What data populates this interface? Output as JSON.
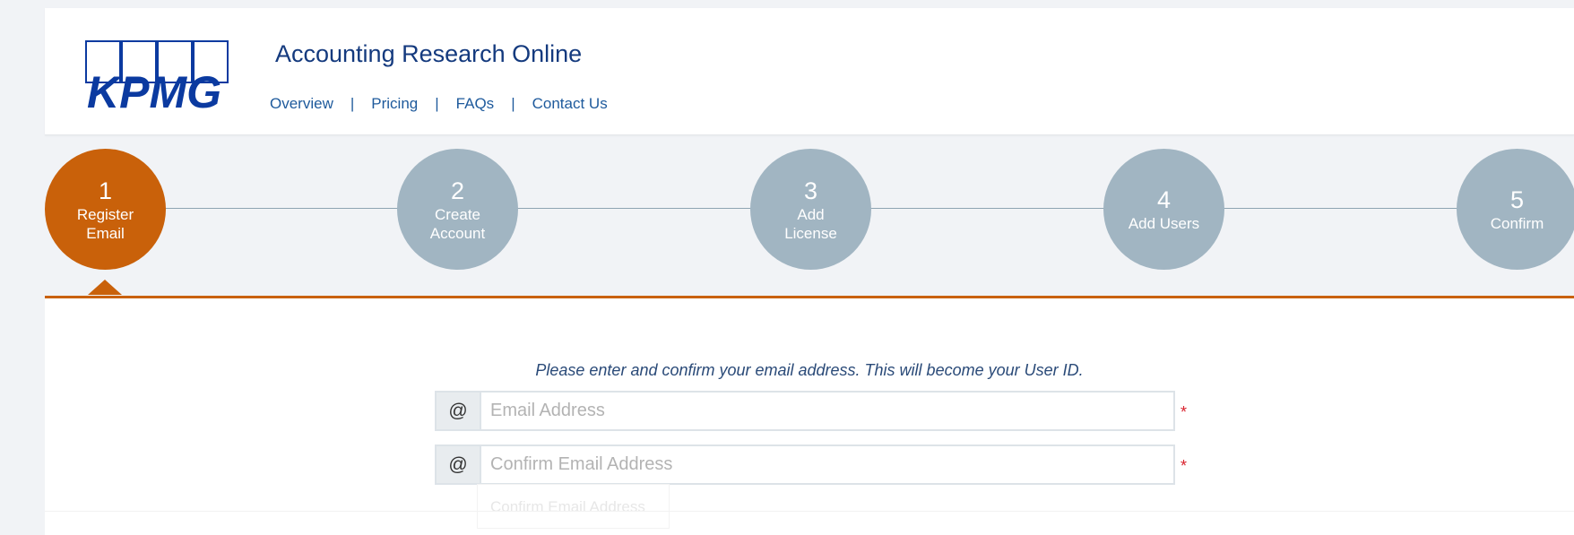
{
  "header": {
    "logo_text": "KPMG",
    "title": "Accounting Research Online",
    "nav": [
      "Overview",
      "Pricing",
      "FAQs",
      "Contact Us"
    ],
    "nav_separator": "|"
  },
  "steps": [
    {
      "number": "1",
      "label": "Register Email",
      "active": true
    },
    {
      "number": "2",
      "label": "Create Account",
      "active": false
    },
    {
      "number": "3",
      "label": "Add License",
      "active": false
    },
    {
      "number": "4",
      "label": "Add Users",
      "active": false
    },
    {
      "number": "5",
      "label": "Confirm",
      "active": false
    }
  ],
  "form": {
    "instruction": "Please enter and confirm your email address. This will become your User ID.",
    "addon_symbol": "@",
    "required_mark": "*",
    "email_placeholder": "Email Address",
    "confirm_placeholder": "Confirm Email Address",
    "ghost_text": "Confirm Email Address"
  },
  "colors": {
    "brand_blue": "#143a7e",
    "link_blue": "#1e5a9c",
    "active_step": "#c9610a",
    "inactive_step": "#a1b5c2",
    "required": "#d9232e"
  }
}
